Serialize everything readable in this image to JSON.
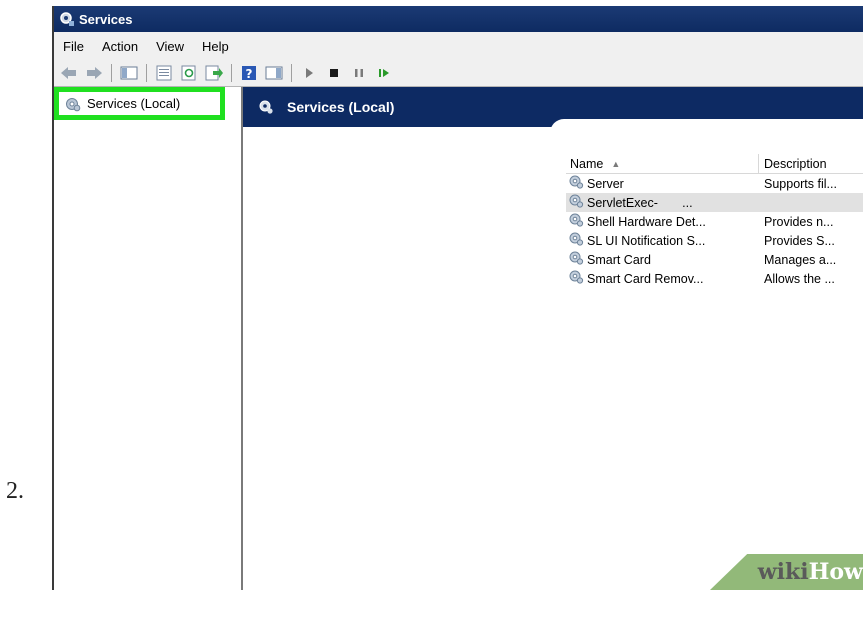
{
  "step_number": "2.",
  "window": {
    "title": "Services"
  },
  "menu": [
    "File",
    "Action",
    "View",
    "Help"
  ],
  "toolbar": {
    "icons": [
      "back-icon",
      "forward-icon",
      "show-hide-tree-icon",
      "properties-icon",
      "refresh-icon",
      "export-list-icon",
      "help-icon",
      "show-hide-action-pane-icon",
      "start-service-icon",
      "stop-service-icon",
      "pause-service-icon",
      "resume-service-icon"
    ]
  },
  "tree": {
    "item_label": "Services (Local)"
  },
  "content": {
    "header": "Services (Local)",
    "columns": [
      "Name",
      "Description"
    ],
    "rows": [
      {
        "name": "Server",
        "description": "Supports fil..."
      },
      {
        "name": "ServletExec-       ...",
        "description": ""
      },
      {
        "name": "Shell Hardware Det...",
        "description": "Provides n..."
      },
      {
        "name": "SL UI Notification S...",
        "description": "Provides S..."
      },
      {
        "name": "Smart Card",
        "description": "Manages a..."
      },
      {
        "name": "Smart Card Remov...",
        "description": "Allows the ..."
      }
    ],
    "selected_row": 1
  },
  "watermark": {
    "part1": "wiki",
    "part2": "How"
  },
  "colors": {
    "title_bar": "#0e2b62",
    "content_header": "#0d2a63",
    "highlight_box": "#20e020",
    "watermark_bg": "#92b979"
  }
}
